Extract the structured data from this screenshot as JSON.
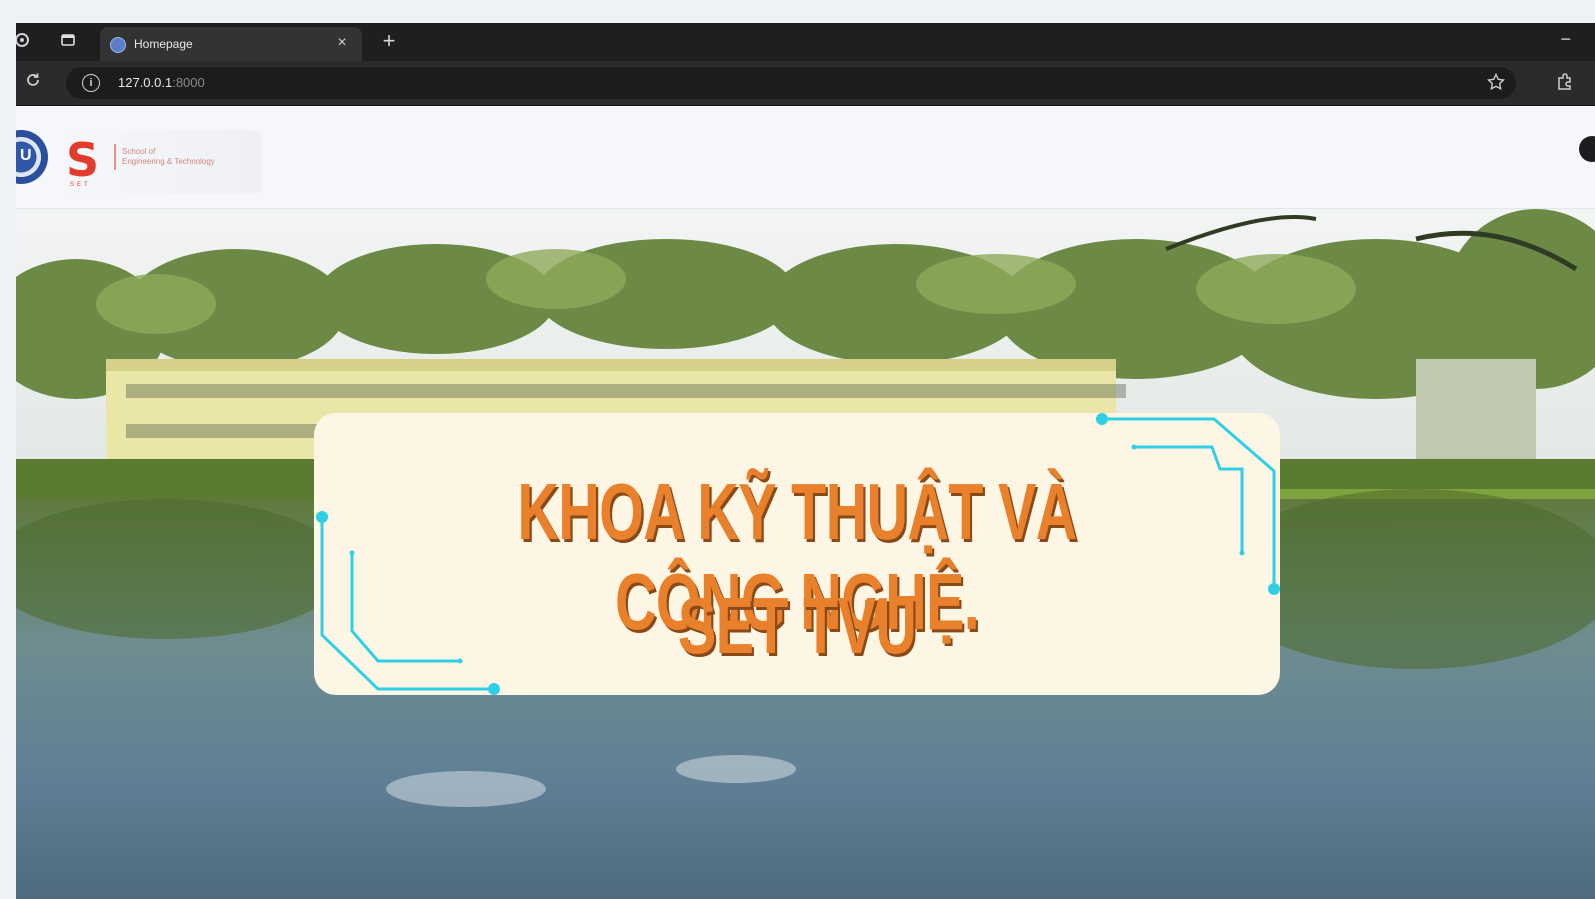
{
  "browser": {
    "tab_title": "Homepage",
    "close_glyph": "×",
    "new_tab_glyph": "+",
    "minimize_glyph": "−",
    "url_host": "127.0.0.1",
    "url_port": ":8000",
    "icons": [
      "extensions-icon",
      "tab-actions-icon",
      "favicon-icon",
      "close-icon",
      "new-tab-icon",
      "reload-icon",
      "site-info-icon",
      "bookmark-star-icon",
      "extension-puzzle-icon",
      "user-icon"
    ]
  },
  "header": {
    "tvu_logo_text": "U",
    "set_logo_letter": "S",
    "set_logo_line1": "School of",
    "set_logo_line2": "Engineering & Technology",
    "set_logo_under": "SET"
  },
  "hero": {
    "line1": "KHOA  KỸ THUẬT VÀ CÔNG NGHỆ.",
    "line2": "SET  TVU",
    "text_color": "#e8802c",
    "banner_bg": "#fdf6e4",
    "accent_line_color": "#2fd0e6"
  }
}
